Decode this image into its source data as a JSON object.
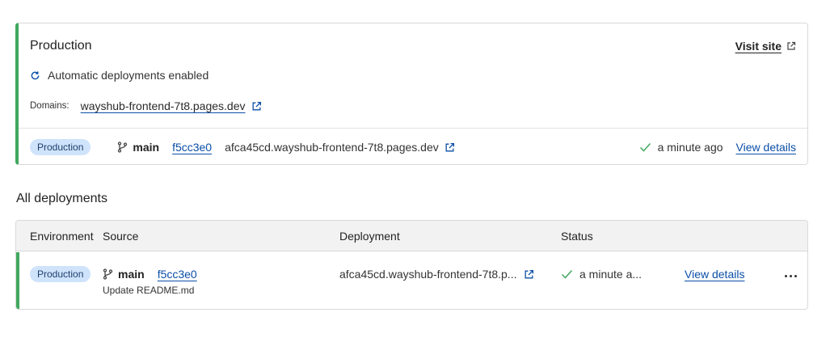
{
  "production": {
    "title": "Production",
    "visit_site": "Visit site",
    "auto_deploy": "Automatic deployments enabled",
    "domains_label": "Domains:",
    "domain": "wayshub-frontend-7t8.pages.dev",
    "latest": {
      "env_badge": "Production",
      "branch": "main",
      "commit": "f5cc3e0",
      "deployment_url": "afca45cd.wayshub-frontend-7t8.pages.dev",
      "status": "a minute ago",
      "view_details": "View details"
    }
  },
  "all_deployments": {
    "title": "All deployments",
    "columns": [
      "Environment",
      "Source",
      "Deployment",
      "Status"
    ],
    "rows": [
      {
        "environment": "Production",
        "branch": "main",
        "commit": "f5cc3e0",
        "commit_message": "Update README.md",
        "deployment": "afca45cd.wayshub-frontend-7t8.p...",
        "status": "a minute a...",
        "view_details": "View details"
      }
    ]
  },
  "colors": {
    "accent_green": "#41a85f",
    "link_blue": "#0b4fa8",
    "badge_bg": "#cfe3fb"
  },
  "icons": [
    "external-link-icon",
    "refresh-icon",
    "branch-icon",
    "check-icon",
    "more-icon"
  ]
}
